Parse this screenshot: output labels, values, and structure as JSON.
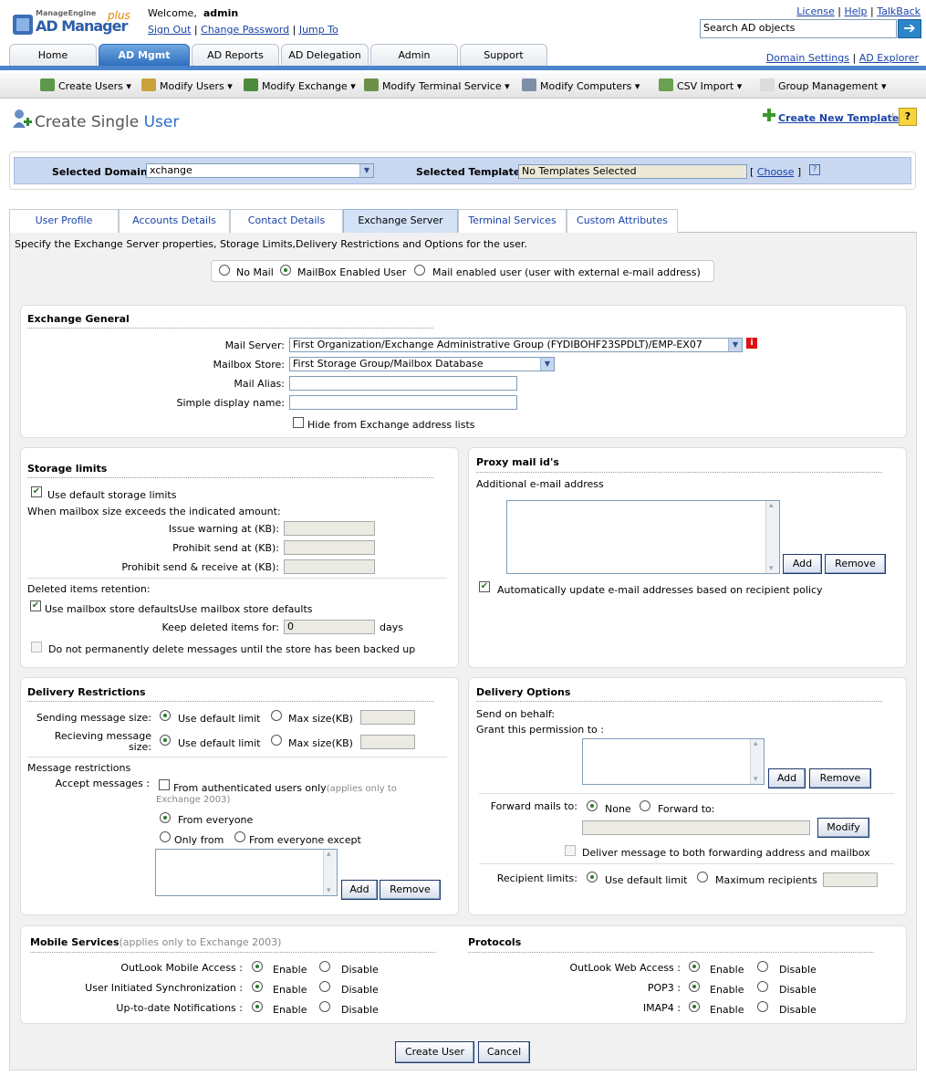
{
  "header": {
    "brand_small": "ManageEngine",
    "brand_big": "AD Manager",
    "brand_plus": "plus",
    "welcome": "Welcome,",
    "user": "admin",
    "signout": "Sign Out",
    "change_pw": "Change Password",
    "jump": "Jump To",
    "license": "License",
    "help": "Help",
    "talkback": "TalkBack",
    "sep": "|",
    "search_placeholder": "Search AD objects",
    "domain_settings": "Domain Settings",
    "ad_explorer": "AD Explorer"
  },
  "tabs": [
    "Home",
    "AD Mgmt",
    "AD Reports",
    "AD Delegation",
    "Admin",
    "Support"
  ],
  "toolbar": [
    "Create Users ▾",
    "Modify Users ▾",
    "Modify Exchange ▾",
    "Modify Terminal Service ▾",
    "Modify Computers ▾",
    "CSV Import ▾",
    "Group Management ▾"
  ],
  "page": {
    "title_a": "Create Single",
    "title_b": "User",
    "create_template": "Create New Template",
    "help_icon": "?"
  },
  "domain": {
    "label": "Selected Domain:",
    "value": "xchange",
    "tpl_label": "Selected Template:",
    "tpl_value": "No Templates Selected",
    "choose_open": "[",
    "choose": "Choose",
    "choose_close": "]",
    "q": "?"
  },
  "subtabs": [
    "User Profile",
    "Accounts Details",
    "Contact Details",
    "Exchange Server",
    "Terminal Services",
    "Custom Attributes"
  ],
  "intro": "Specify the Exchange Server properties, Storage Limits,Delivery Restrictions and Options for the user.",
  "mailtype": {
    "no_mail": "No Mail",
    "mailbox": "MailBox Enabled User",
    "mail_enabled": "Mail enabled user (user with external e-mail address)"
  },
  "exch": {
    "title": "Exchange General",
    "mail_server_lbl": "Mail Server:",
    "mail_server": "First Organization/Exchange Administrative Group (FYDIBOHF23SPDLT)/EMP-EX07",
    "info": "i",
    "store_lbl": "Mailbox Store:",
    "store": "First Storage Group/Mailbox Database",
    "alias_lbl": "Mail Alias:",
    "display_lbl": "Simple display name:",
    "hide": "Hide from Exchange address lists"
  },
  "storage": {
    "title": "Storage limits",
    "use_default": "Use default storage limits",
    "when": "When mailbox size exceeds the indicated amount:",
    "warn": "Issue warning at (KB):",
    "prohibit_send": "Prohibit send at (KB):",
    "prohibit_sr": "Prohibit send & receive at (KB):",
    "deleted": "Deleted items retention:",
    "use_store": "Use mailbox store defaultsUse mailbox store defaults",
    "keep": "Keep deleted items for:",
    "keep_val": "0",
    "days": "days",
    "donot": "Do not permanently delete messages until the store has been backed up"
  },
  "proxy": {
    "title": "Proxy mail id's",
    "additional": "Additional e-mail address",
    "add": "Add",
    "remove": "Remove",
    "auto": "Automatically update e-mail addresses based on recipient policy"
  },
  "delivery": {
    "title": "Delivery Restrictions",
    "sending": "Sending message size:",
    "recv1": "Recieving message",
    "recv2": "size:",
    "use_default": "Use default limit",
    "max": "Max size(KB)",
    "msg_restr": "Message restrictions",
    "accept": "Accept messages :",
    "from_auth": "From authenticated users only",
    "applies": "(applies only to",
    "exch03": "Exchange 2003)",
    "from_everyone": "From everyone",
    "only_from": "Only from",
    "except": "From everyone except",
    "add": "Add",
    "remove": "Remove"
  },
  "options": {
    "title": "Delivery Options",
    "send_behalf": "Send on behalf:",
    "grant": "Grant this permission to :",
    "add": "Add",
    "remove": "Remove",
    "forward": "Forward mails to:",
    "none": "None",
    "forward_to": "Forward to:",
    "modify": "Modify",
    "deliver_both": "Deliver message to both forwarding address and mailbox",
    "recip": "Recipient limits:",
    "use_default": "Use default limit",
    "max_recip": "Maximum recipients"
  },
  "mobile": {
    "title": "Mobile Services",
    "note": "(applies only to Exchange 2003)",
    "oma": "OutLook Mobile Access :",
    "uis": "User Initiated Synchronization :",
    "utd": "Up-to-date Notifications :",
    "enable": "Enable",
    "disable": "Disable"
  },
  "protocols": {
    "title": "Protocols",
    "owa": "OutLook Web Access :",
    "pop3": "POP3 :",
    "imap4": "IMAP4 :",
    "enable": "Enable",
    "disable": "Disable"
  },
  "actions": {
    "create": "Create User",
    "cancel": "Cancel"
  }
}
